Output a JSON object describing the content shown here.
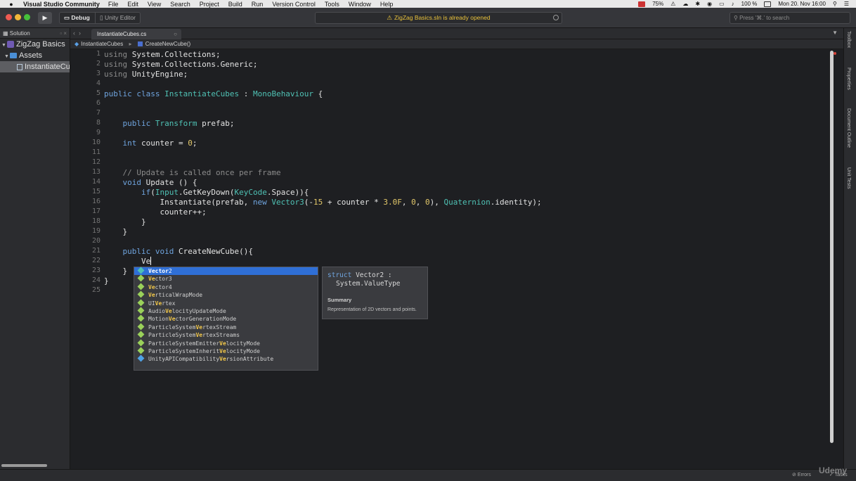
{
  "menubar": {
    "app_name": "Visual Studio Community",
    "items": [
      "File",
      "Edit",
      "View",
      "Search",
      "Project",
      "Build",
      "Run",
      "Version Control",
      "Tools",
      "Window",
      "Help"
    ],
    "battery_pct": "75%",
    "zoom": "100 %",
    "datetime": "Mon 20. Nov 16:00"
  },
  "toolbar": {
    "config": "Debug",
    "target": "Unity Editor",
    "status": "ZigZag Basics.sln is already opened",
    "search_placeholder": "Press '⌘.' to search"
  },
  "solution_pad": {
    "title": "Solution",
    "tree": [
      {
        "label": "ZigZag Basics",
        "kind": "solution"
      },
      {
        "label": "Assets",
        "kind": "folder"
      },
      {
        "label": "InstantiateCubes.cs",
        "kind": "file",
        "selected": true
      }
    ]
  },
  "tabs": [
    {
      "label": "InstantiateCubes.cs"
    }
  ],
  "breadcrumb": {
    "class_name": "InstantiateCubes",
    "method_name": "CreateNewCube()"
  },
  "editor": {
    "line_numbers": [
      "1",
      "2",
      "3",
      "4",
      "5",
      "6",
      "7",
      "8",
      "9",
      "10",
      "11",
      "12",
      "13",
      "14",
      "15",
      "16",
      "17",
      "18",
      "19",
      "20",
      "21",
      "22",
      "23",
      "24",
      "25"
    ]
  },
  "completion": {
    "typed": "Ve",
    "items": [
      {
        "pre": "",
        "hl": "Vector",
        "post": "2",
        "kind": "struct",
        "color": "#4fc1b4"
      },
      {
        "pre": "",
        "hl": "Ve",
        "post": "ctor3",
        "kind": "struct",
        "color": "#9ad15a"
      },
      {
        "pre": "",
        "hl": "Ve",
        "post": "ctor4",
        "kind": "struct",
        "color": "#9ad15a"
      },
      {
        "pre": "",
        "hl": "Ve",
        "post": "rticalWrapMode",
        "kind": "enum",
        "color": "#9ad15a"
      },
      {
        "pre": "UI",
        "hl": "Ve",
        "post": "rtex",
        "kind": "struct",
        "color": "#9ad15a"
      },
      {
        "pre": "Audio",
        "hl": "Ve",
        "post": "locityUpdateMode",
        "kind": "enum",
        "color": "#9ad15a"
      },
      {
        "pre": "Motion",
        "hl": "Ve",
        "post": "ctorGenerationMode",
        "kind": "enum",
        "color": "#9ad15a"
      },
      {
        "pre": "ParticleSystem",
        "hl": "Ve",
        "post": "rtexStream",
        "kind": "enum",
        "color": "#9ad15a"
      },
      {
        "pre": "ParticleSystem",
        "hl": "Ve",
        "post": "rtexStreams",
        "kind": "struct",
        "color": "#9ad15a"
      },
      {
        "pre": "ParticleSystemEmitter",
        "hl": "Ve",
        "post": "locityMode",
        "kind": "enum",
        "color": "#9ad15a"
      },
      {
        "pre": "ParticleSystemInherit",
        "hl": "Ve",
        "post": "locityMode",
        "kind": "enum",
        "color": "#9ad15a"
      },
      {
        "pre": "UnityAPICompatibility",
        "hl": "Ve",
        "post": "rsionAttribute",
        "kind": "class",
        "color": "#4fa2e6"
      }
    ]
  },
  "tooltip": {
    "keyword": "struct",
    "name": "Vector2 :",
    "base": "System.ValueType",
    "summary_title": "Summary",
    "summary_text": "Representation of 2D vectors and points."
  },
  "right_dock": {
    "items": [
      "Toolbox",
      "Properties",
      "Document Outline",
      "Unit Tests"
    ]
  },
  "statusbar": {
    "errors": "Errors",
    "tasks": "Tasks"
  },
  "watermark": "Udemy"
}
